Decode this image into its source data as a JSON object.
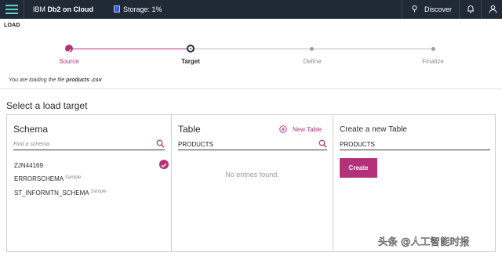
{
  "colors": {
    "topbar": "#1f2a36",
    "accent": "#b4317a",
    "menu": "#5fd3c6"
  },
  "topbar": {
    "product_prefix": "IBM",
    "product_name": "Db2 on Cloud",
    "storage_label": "Storage: 1%",
    "discover_label": "Discover",
    "icons": [
      "hamburger-menu-icon",
      "storage-icon",
      "lightbulb-icon",
      "bell-icon",
      "user-icon"
    ]
  },
  "page": {
    "title": "LOAD"
  },
  "stepper": {
    "steps": [
      {
        "label": "Source",
        "state": "complete"
      },
      {
        "label": "Target",
        "state": "current"
      },
      {
        "label": "Define",
        "state": "pending"
      },
      {
        "label": "Finalize",
        "state": "pending"
      }
    ]
  },
  "loading_note": {
    "prefix": "You are loading the file",
    "filename": "products .csv"
  },
  "section_title": "Select a load target",
  "schema_panel": {
    "title": "Schema",
    "search_placeholder": "Find a schema",
    "items": [
      {
        "name": "ZJN44169",
        "tag": "",
        "selected": true
      },
      {
        "name": "ERRORSCHEMA",
        "tag": "Sample",
        "selected": false
      },
      {
        "name": "ST_INFORMTN_SCHEMA",
        "tag": "Sample",
        "selected": false
      }
    ]
  },
  "table_panel": {
    "title": "Table",
    "new_table_label": "New Table",
    "search_value": "PRODUCTS",
    "empty_message": "No entries found."
  },
  "create_panel": {
    "title": "Create a new Table",
    "table_name_value": "PRODUCTS",
    "create_label": "Create"
  },
  "watermark": {
    "text": "头条 @人工智能时报"
  }
}
